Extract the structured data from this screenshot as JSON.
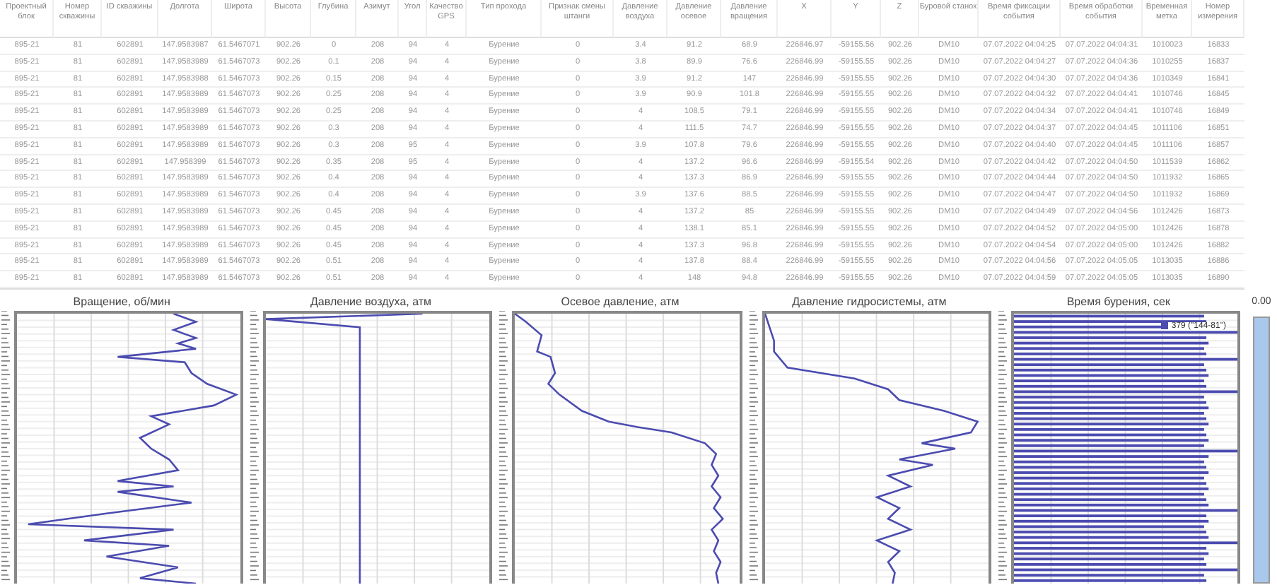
{
  "table": {
    "columns": [
      "Проектный блок",
      "Номер скважины",
      "ID скважины",
      "Долгота",
      "Широта",
      "Высота",
      "Глубина",
      "Азимут",
      "Угол",
      "Качество GPS",
      "Тип прохода",
      "Признак смены штанги",
      "Давление воздуха",
      "Давление осевое",
      "Давление вращения",
      "X",
      "Y",
      "Z",
      "Буровой станок",
      "Время фиксации события",
      "Время обработки события",
      "Временная метка",
      "Номер измерения"
    ],
    "rows": [
      [
        "895-21",
        "81",
        "602891",
        "147.9583987",
        "61.5467071",
        "902.26",
        "0",
        "208",
        "94",
        "4",
        "Бурение",
        "0",
        "3.4",
        "91.2",
        "68.9",
        "226846.97",
        "-59155.56",
        "902.26",
        "DM10",
        "07.07.2022 04:04:25",
        "07.07.2022 04:04:31",
        "1010023",
        "16833"
      ],
      [
        "895-21",
        "81",
        "602891",
        "147.9583989",
        "61.5467073",
        "902.26",
        "0.1",
        "208",
        "94",
        "4",
        "Бурение",
        "0",
        "3.8",
        "89.9",
        "76.6",
        "226846.99",
        "-59155.55",
        "902.26",
        "DM10",
        "07.07.2022 04:04:27",
        "07.07.2022 04:04:36",
        "1010255",
        "16837"
      ],
      [
        "895-21",
        "81",
        "602891",
        "147.9583988",
        "61.5467073",
        "902.26",
        "0.15",
        "208",
        "94",
        "4",
        "Бурение",
        "0",
        "3.9",
        "91.2",
        "147",
        "226846.99",
        "-59155.55",
        "902.26",
        "DM10",
        "07.07.2022 04:04:30",
        "07.07.2022 04:04:36",
        "1010349",
        "16841"
      ],
      [
        "895-21",
        "81",
        "602891",
        "147.9583989",
        "61.5467073",
        "902.26",
        "0.25",
        "208",
        "94",
        "4",
        "Бурение",
        "0",
        "3.9",
        "90.9",
        "101.8",
        "226846.99",
        "-59155.55",
        "902.26",
        "DM10",
        "07.07.2022 04:04:32",
        "07.07.2022 04:04:41",
        "1010746",
        "16845"
      ],
      [
        "895-21",
        "81",
        "602891",
        "147.9583989",
        "61.5467073",
        "902.26",
        "0.25",
        "208",
        "94",
        "4",
        "Бурение",
        "0",
        "4",
        "108.5",
        "79.1",
        "226846.99",
        "-59155.55",
        "902.26",
        "DM10",
        "07.07.2022 04:04:34",
        "07.07.2022 04:04:41",
        "1010746",
        "16849"
      ],
      [
        "895-21",
        "81",
        "602891",
        "147.9583989",
        "61.5467073",
        "902.26",
        "0.3",
        "208",
        "94",
        "4",
        "Бурение",
        "0",
        "4",
        "111.5",
        "74.7",
        "226846.99",
        "-59155.55",
        "902.26",
        "DM10",
        "07.07.2022 04:04:37",
        "07.07.2022 04:04:45",
        "1011106",
        "16851"
      ],
      [
        "895-21",
        "81",
        "602891",
        "147.9583989",
        "61.5467073",
        "902.26",
        "0.3",
        "208",
        "95",
        "4",
        "Бурение",
        "0",
        "3.9",
        "107.8",
        "79.6",
        "226846.99",
        "-59155.55",
        "902.26",
        "DM10",
        "07.07.2022 04:04:40",
        "07.07.2022 04:04:45",
        "1011106",
        "16857"
      ],
      [
        "895-21",
        "81",
        "602891",
        "147.958399",
        "61.5467073",
        "902.26",
        "0.35",
        "208",
        "95",
        "4",
        "Бурение",
        "0",
        "4",
        "137.2",
        "96.6",
        "226846.99",
        "-59155.54",
        "902.26",
        "DM10",
        "07.07.2022 04:04:42",
        "07.07.2022 04:04:50",
        "1011539",
        "16862"
      ],
      [
        "895-21",
        "81",
        "602891",
        "147.9583989",
        "61.5467073",
        "902.26",
        "0.4",
        "208",
        "94",
        "4",
        "Бурение",
        "0",
        "4",
        "137.3",
        "86.9",
        "226846.99",
        "-59155.55",
        "902.26",
        "DM10",
        "07.07.2022 04:04:44",
        "07.07.2022 04:04:50",
        "1011932",
        "16865"
      ],
      [
        "895-21",
        "81",
        "602891",
        "147.9583989",
        "61.5467073",
        "902.26",
        "0.4",
        "208",
        "94",
        "4",
        "Бурение",
        "0",
        "3.9",
        "137.6",
        "88.5",
        "226846.99",
        "-59155.55",
        "902.26",
        "DM10",
        "07.07.2022 04:04:47",
        "07.07.2022 04:04:50",
        "1011932",
        "16869"
      ],
      [
        "895-21",
        "81",
        "602891",
        "147.9583989",
        "61.5467073",
        "902.26",
        "0.45",
        "208",
        "94",
        "4",
        "Бурение",
        "0",
        "4",
        "137.2",
        "85",
        "226846.99",
        "-59155.55",
        "902.26",
        "DM10",
        "07.07.2022 04:04:49",
        "07.07.2022 04:04:56",
        "1012426",
        "16873"
      ],
      [
        "895-21",
        "81",
        "602891",
        "147.9583989",
        "61.5467073",
        "902.26",
        "0.45",
        "208",
        "94",
        "4",
        "Бурение",
        "0",
        "4",
        "138.1",
        "85.1",
        "226846.99",
        "-59155.55",
        "902.26",
        "DM10",
        "07.07.2022 04:04:52",
        "07.07.2022 04:05:00",
        "1012426",
        "16878"
      ],
      [
        "895-21",
        "81",
        "602891",
        "147.9583989",
        "61.5467073",
        "902.26",
        "0.45",
        "208",
        "94",
        "4",
        "Бурение",
        "0",
        "4",
        "137.3",
        "96.8",
        "226846.99",
        "-59155.55",
        "902.26",
        "DM10",
        "07.07.2022 04:04:54",
        "07.07.2022 04:05:00",
        "1012426",
        "16882"
      ],
      [
        "895-21",
        "81",
        "602891",
        "147.9583989",
        "61.5467073",
        "902.26",
        "0.51",
        "208",
        "94",
        "4",
        "Бурение",
        "0",
        "4",
        "137.8",
        "88.4",
        "226846.99",
        "-59155.55",
        "902.26",
        "DM10",
        "07.07.2022 04:04:56",
        "07.07.2022 04:05:05",
        "1013035",
        "16886"
      ],
      [
        "895-21",
        "81",
        "602891",
        "147.9583989",
        "61.5467073",
        "902.26",
        "0.51",
        "208",
        "94",
        "4",
        "Бурение",
        "0",
        "4",
        "148",
        "94.8",
        "226846.99",
        "-59155.55",
        "902.26",
        "DM10",
        "07.07.2022 04:04:59",
        "07.07.2022 04:05:05",
        "1013035",
        "16890"
      ]
    ]
  },
  "charts": [
    {
      "title": "Вращение, об/мин",
      "kind": "line"
    },
    {
      "title": "Давление воздуха, атм",
      "kind": "line"
    },
    {
      "title": "Осевое давление, атм",
      "kind": "line"
    },
    {
      "title": "Давление гидросистемы, атм",
      "kind": "line"
    },
    {
      "title": "Время бурения, сек",
      "kind": "bars",
      "legend": {
        "label": "379 (\"144-81\")",
        "color": "#4b4bb0"
      }
    }
  ],
  "side_panel": {
    "reading": "0.00"
  }
}
